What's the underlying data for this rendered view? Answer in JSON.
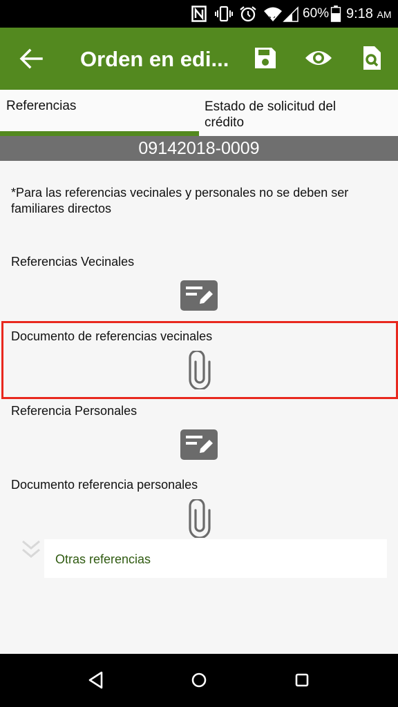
{
  "status_bar": {
    "icons": [
      "nfc-icon",
      "vibrate-icon",
      "alarm-icon",
      "wifi-icon",
      "signal-icon",
      "battery-icon"
    ],
    "battery": "60%",
    "time": "9:18",
    "ampm": "AM"
  },
  "app_bar": {
    "title": "Orden en edi...",
    "back_icon": "arrow-back-icon",
    "actions": [
      "save-icon",
      "eye-icon",
      "document-search-icon"
    ],
    "color": "#53891f"
  },
  "tabs": [
    {
      "label": "Referencias",
      "selected": true
    },
    {
      "label": "Estado de solicitud del crédito",
      "selected": false
    }
  ],
  "order_number": "09142018-0009",
  "note": "*Para las referencias vecinales y personales no se deben ser familiares directos",
  "sections": [
    {
      "label": "Referencias Vecinales",
      "icon": "edit-note-icon"
    },
    {
      "label": "Documento de referencias vecinales",
      "icon": "paperclip-icon",
      "highlighted": true
    },
    {
      "label": "Referencia Personales",
      "icon": "edit-note-icon"
    },
    {
      "label": "Documento referencia personales",
      "icon": "paperclip-icon"
    }
  ],
  "otras_referencias": "Otras referencias",
  "highlight_color": "#e8281e",
  "nav_bar": {
    "buttons": [
      "back-triangle-icon",
      "home-circle-icon",
      "recents-square-icon"
    ]
  }
}
